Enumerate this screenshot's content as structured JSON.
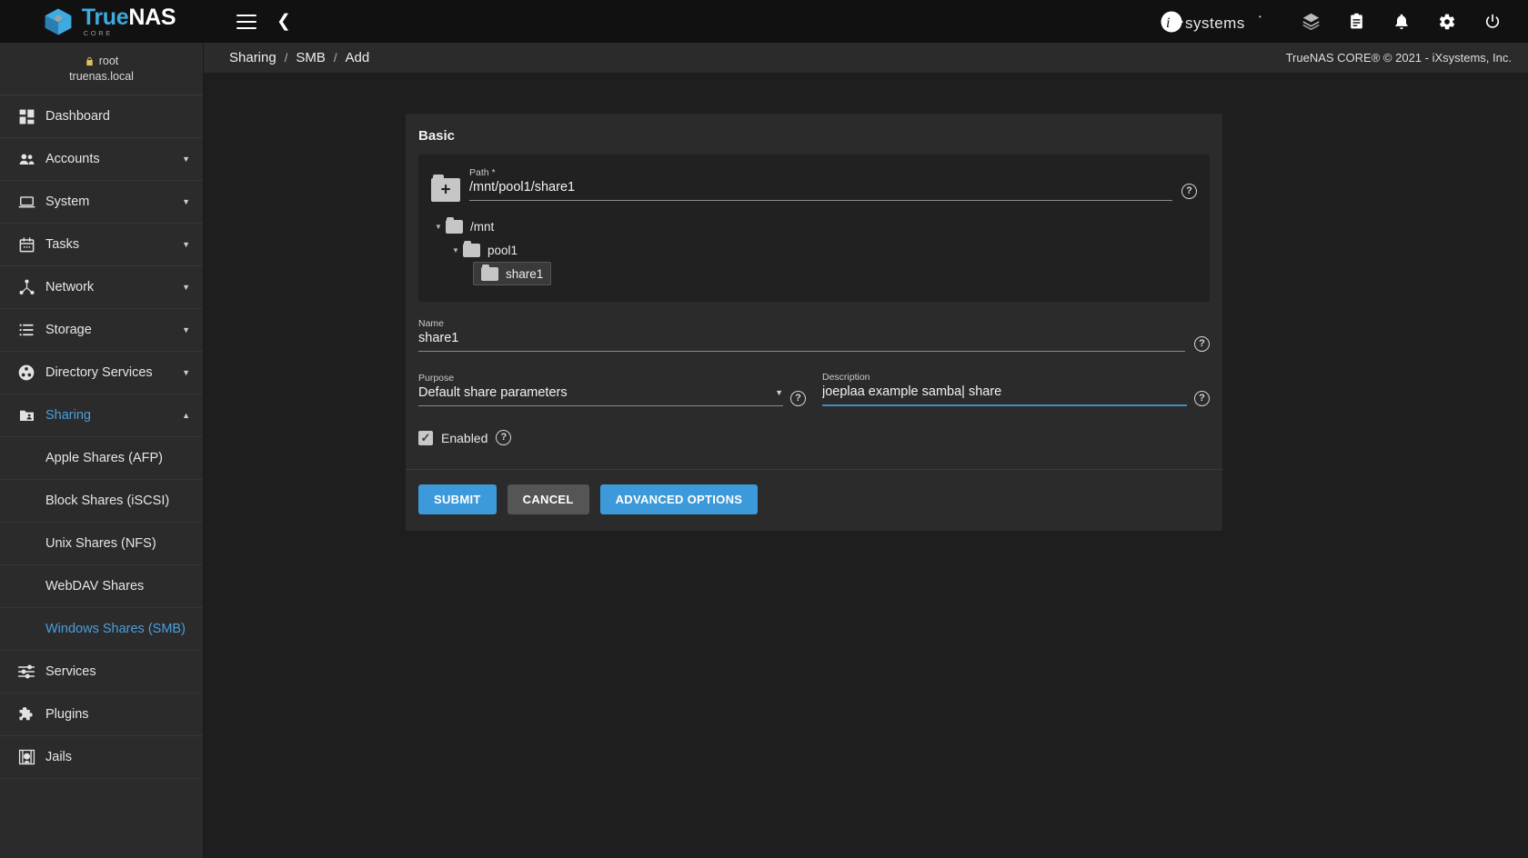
{
  "app": {
    "brand_true": "True",
    "brand_nas": "NAS",
    "brand_sub": "CORE",
    "vendor_logo": "ix-systems-logo",
    "accent_color": "#3c9ada",
    "link_color": "#4a9fdc"
  },
  "topbar": {
    "menu_icon": "hamburger-menu-icon",
    "back_icon": "chevron-left-icon",
    "icons": [
      {
        "name": "cube-stack-icon",
        "label": "Plugins / Jobs"
      },
      {
        "name": "clipboard-icon",
        "label": "Task Manager"
      },
      {
        "name": "bell-icon",
        "label": "Alerts"
      },
      {
        "name": "gear-icon",
        "label": "Settings"
      },
      {
        "name": "power-icon",
        "label": "Power"
      }
    ]
  },
  "sidebar": {
    "user": {
      "name": "root",
      "host": "truenas.local",
      "lock_icon": "lock-icon"
    },
    "items": [
      {
        "label": "Dashboard",
        "icon": "dashboard-grid-icon",
        "chevron": "",
        "active": false
      },
      {
        "label": "Accounts",
        "icon": "users-icon",
        "chevron": "▼",
        "active": false
      },
      {
        "label": "System",
        "icon": "laptop-icon",
        "chevron": "▼",
        "active": false
      },
      {
        "label": "Tasks",
        "icon": "calendar-icon",
        "chevron": "▼",
        "active": false
      },
      {
        "label": "Network",
        "icon": "network-icon",
        "chevron": "▼",
        "active": false
      },
      {
        "label": "Storage",
        "icon": "storage-list-icon",
        "chevron": "▼",
        "active": false
      },
      {
        "label": "Directory Services",
        "icon": "directory-services-icon",
        "chevron": "▼",
        "active": false
      },
      {
        "label": "Sharing",
        "icon": "share-folder-icon",
        "chevron": "▲",
        "active": true
      }
    ],
    "sharing_children": [
      {
        "label": "Apple Shares (AFP)",
        "active": false
      },
      {
        "label": "Block Shares (iSCSI)",
        "active": false
      },
      {
        "label": "Unix Shares (NFS)",
        "active": false
      },
      {
        "label": "WebDAV Shares",
        "active": false
      },
      {
        "label": "Windows Shares (SMB)",
        "active": true
      }
    ],
    "items_after": [
      {
        "label": "Services",
        "icon": "sliders-icon",
        "chevron": "",
        "active": false
      },
      {
        "label": "Plugins",
        "icon": "puzzle-icon",
        "chevron": "",
        "active": false
      },
      {
        "label": "Jails",
        "icon": "jail-icon",
        "chevron": "",
        "active": false
      }
    ]
  },
  "breadcrumb": {
    "items": [
      "Sharing",
      "SMB",
      "Add"
    ],
    "separator": "/",
    "copyright": "TrueNAS CORE® © 2021 - iXsystems, Inc."
  },
  "form": {
    "card_title": "Basic",
    "path": {
      "label": "Path *",
      "value": "/mnt/pool1/share1",
      "add_folder_icon": "add-folder-icon",
      "help_icon": "help-icon"
    },
    "tree": [
      {
        "label": "/mnt",
        "level": 1,
        "caret": "▼",
        "selected": false
      },
      {
        "label": "pool1",
        "level": 2,
        "caret": "▼",
        "selected": false
      },
      {
        "label": "share1",
        "level": 3,
        "caret": "",
        "selected": true
      }
    ],
    "name": {
      "label": "Name",
      "value": "share1",
      "help_icon": "help-icon"
    },
    "purpose": {
      "label": "Purpose",
      "value": "Default share parameters",
      "caret": "▼",
      "help_icon": "help-icon"
    },
    "description": {
      "label": "Description",
      "value": "joeplaa example samba| share",
      "focused": true,
      "help_icon": "help-icon"
    },
    "enabled": {
      "label": "Enabled",
      "checked": true,
      "tick": "✓",
      "help_icon": "help-icon"
    },
    "buttons": {
      "submit": "SUBMIT",
      "cancel": "CANCEL",
      "advanced": "ADVANCED OPTIONS"
    }
  }
}
